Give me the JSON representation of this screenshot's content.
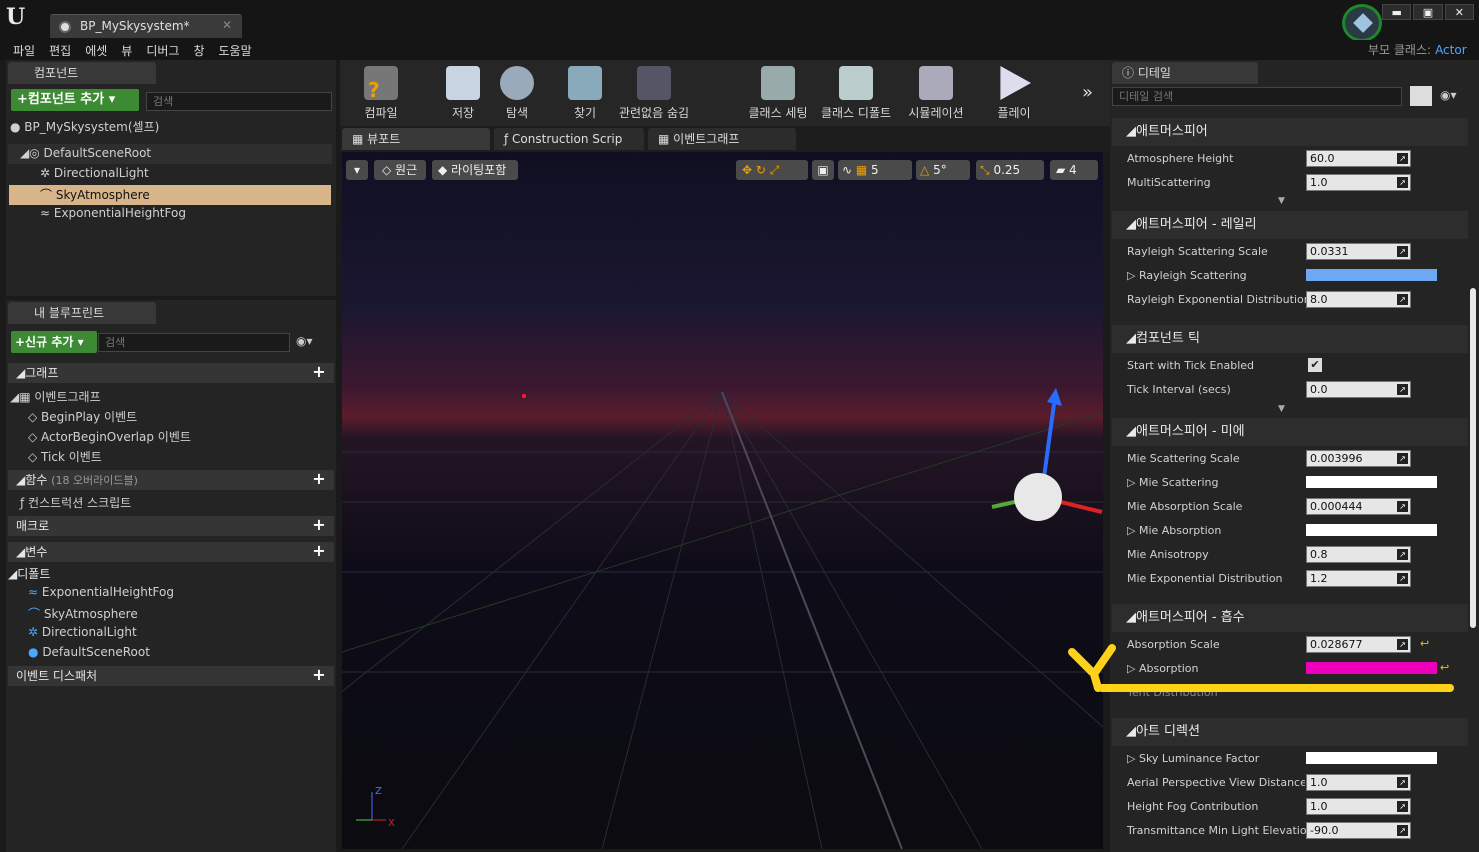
{
  "window": {
    "doc_tab": "BP_MySkysystem*",
    "parent_class_label": "부모 클래스:",
    "parent_class_value": "Actor",
    "btn_min": "▬",
    "btn_max": "▣",
    "btn_close": "✕"
  },
  "menu": [
    "파일",
    "편집",
    "에셋",
    "뷰",
    "디버그",
    "창",
    "도움말"
  ],
  "components": {
    "tab": "컴포넌트",
    "add_button": "+컴포넌트 추가 ▾",
    "search_placeholder": "검색",
    "self": "BP_MySkysystem(셀프)",
    "tree": [
      "DefaultSceneRoot",
      "DirectionalLight",
      "SkyAtmosphere",
      "ExponentialHeightFog"
    ]
  },
  "my_blueprint": {
    "tab": "내 블루프린트",
    "add_button": "+신규 추가 ▾",
    "search_placeholder": "검색",
    "graph_header": "그래프",
    "event_graph": "이벤트그래프",
    "events": [
      "BeginPlay 이벤트",
      "ActorBeginOverlap 이벤트",
      "Tick 이벤트"
    ],
    "functions_header": "함수",
    "functions_note": "(18 오버라이드블)",
    "construction_script": "컨스트럭션 스크립트",
    "macros_header": "매크로",
    "variables_header": "변수",
    "defaults_header": "디폴트",
    "defaults": [
      "ExponentialHeightFog",
      "SkyAtmosphere",
      "DirectionalLight",
      "DefaultSceneRoot"
    ],
    "dispatchers_header": "이벤트 디스패처"
  },
  "toolbar": [
    "컴파일",
    "저장",
    "탐색",
    "찾기",
    "관련없음 숨김",
    "클래스 세팅",
    "클래스 디폴트",
    "시뮬레이션",
    "플레이"
  ],
  "viewport_tabs": [
    "뷰포트",
    "Construction Scrip",
    "이벤트그래프"
  ],
  "viewport": {
    "perspective": "원근",
    "lit": "라이팅포함",
    "grid_snap": "5",
    "rot_snap": "5°",
    "scale_snap": "0.25",
    "cam_speed": "4",
    "axis_x": "X",
    "axis_z": "Z"
  },
  "details": {
    "tab": "디테일",
    "search_placeholder": "디테일 검색",
    "categories": {
      "atmosphere": "애트머스피어",
      "rayleigh": "애트머스피어 - 레일리",
      "tick": "컴포넌트 틱",
      "mie": "애트머스피어 - 미에",
      "absorption": "애트머스피어 - 흡수",
      "art": "아트 디렉션"
    },
    "props": {
      "atmosphere_height": {
        "label": "Atmosphere Height",
        "value": "60.0"
      },
      "multiscattering": {
        "label": "MultiScattering",
        "value": "1.0"
      },
      "rayleigh_scale": {
        "label": "Rayleigh Scattering Scale",
        "value": "0.0331"
      },
      "rayleigh_scattering": {
        "label": "Rayleigh Scattering"
      },
      "rayleigh_exp": {
        "label": "Rayleigh Exponential Distribution",
        "value": "8.0"
      },
      "tick_enabled": {
        "label": "Start with Tick Enabled"
      },
      "tick_interval": {
        "label": "Tick Interval (secs)",
        "value": "0.0"
      },
      "mie_scale": {
        "label": "Mie Scattering Scale",
        "value": "0.003996"
      },
      "mie_scattering": {
        "label": "Mie Scattering"
      },
      "mie_abs_scale": {
        "label": "Mie Absorption Scale",
        "value": "0.000444"
      },
      "mie_absorption": {
        "label": "Mie Absorption"
      },
      "mie_aniso": {
        "label": "Mie Anisotropy",
        "value": "0.8"
      },
      "mie_exp": {
        "label": "Mie Exponential Distribution",
        "value": "1.2"
      },
      "abs_scale": {
        "label": "Absorption Scale",
        "value": "0.028677"
      },
      "absorption": {
        "label": "Absorption"
      },
      "tent": {
        "label": "Tent Distribution"
      },
      "sky_lum": {
        "label": "Sky Luminance Factor"
      },
      "aerial": {
        "label": "Aerial Perspective View Distance Sc",
        "value": "1.0"
      },
      "height_fog": {
        "label": "Height Fog Contribution",
        "value": "1.0"
      },
      "trans_min": {
        "label": "Transmittance Min Light Elevation",
        "value": "-90.0"
      }
    },
    "colors": {
      "rayleigh": "#6fa8f2",
      "white": "#ffffff",
      "absorption": "#ee00bb",
      "annotation": "#ffd21a"
    }
  }
}
